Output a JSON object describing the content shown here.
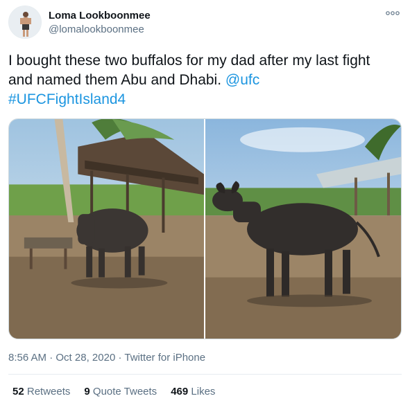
{
  "author": {
    "display_name": "Loma Lookboonmee",
    "handle": "@lomalookboonmee"
  },
  "tweet": {
    "text_plain": "I bought these two buffalos for my dad after my last fight and named them Abu and Dhabi. ",
    "mention": "@ufc",
    "hashtag": "#UFCFightIsland4"
  },
  "meta": {
    "time": "8:56 AM",
    "sep1": " · ",
    "date": "Oct 28, 2020",
    "sep2": " · ",
    "source": "Twitter for iPhone"
  },
  "stats": {
    "retweets_count": "52",
    "retweets_label": "Retweets",
    "quotes_count": "9",
    "quotes_label": "Quote Tweets",
    "likes_count": "469",
    "likes_label": "Likes"
  },
  "icons": {
    "more": "more-dots-icon"
  },
  "colors": {
    "link": "#1b95e0",
    "secondary_text": "#5b7083",
    "divider": "#e6ecf0"
  }
}
